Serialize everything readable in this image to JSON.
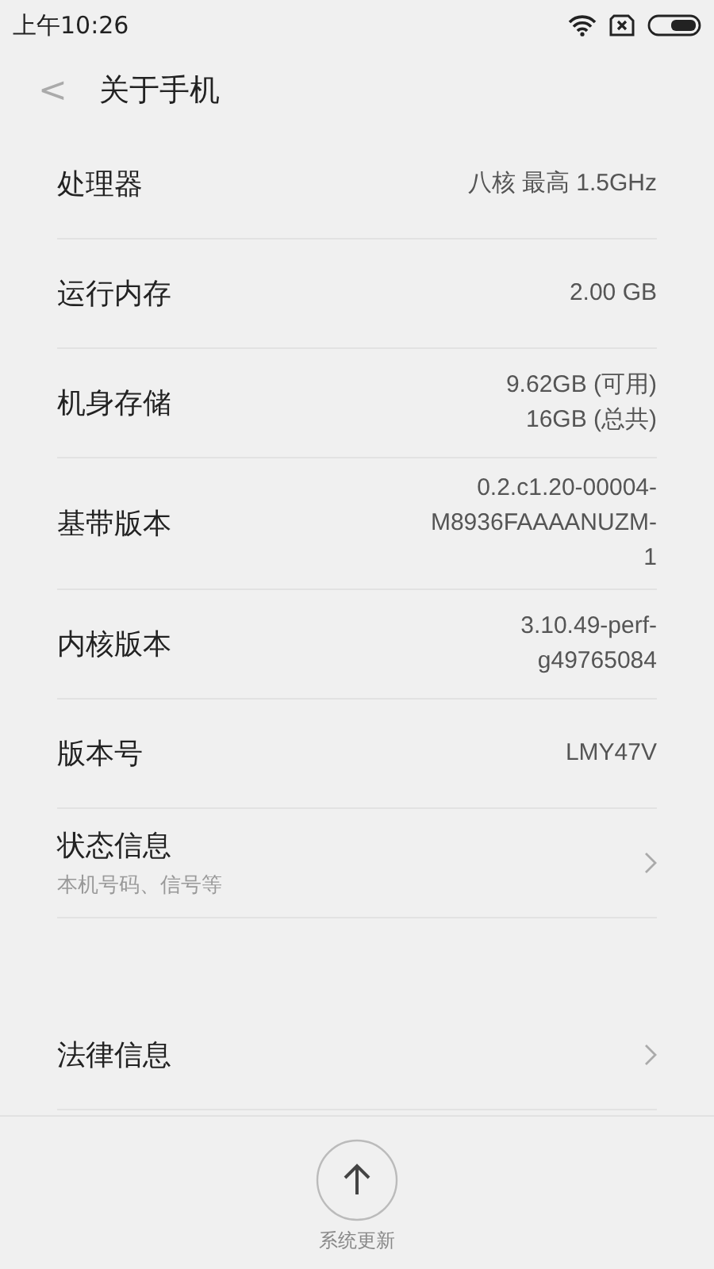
{
  "status_bar": {
    "time": "上午10:26"
  },
  "header": {
    "back": "<",
    "title": "关于手机"
  },
  "sections": [
    {
      "items": [
        {
          "kind": "value",
          "label": "处理器",
          "value_lines": [
            "八核 最高 1.5GHz"
          ]
        },
        {
          "kind": "value",
          "label": "运行内存",
          "value_lines": [
            "2.00 GB"
          ]
        },
        {
          "kind": "value",
          "label": "机身存储",
          "value_lines": [
            "9.62GB (可用)",
            "16GB (总共)"
          ]
        },
        {
          "kind": "value",
          "label": "基带版本",
          "value_lines": [
            "0.2.c1.20-00004-",
            "M8936FAAAANUZM-",
            "1"
          ]
        },
        {
          "kind": "value",
          "label": "内核版本",
          "value_lines": [
            "3.10.49-perf-",
            "g49765084"
          ]
        },
        {
          "kind": "value",
          "label": "版本号",
          "value_lines": [
            "LMY47V"
          ]
        },
        {
          "kind": "link",
          "label": "状态信息",
          "subtitle": "本机号码、信号等"
        }
      ]
    },
    {
      "items": [
        {
          "kind": "link",
          "label": "法律信息"
        }
      ]
    }
  ],
  "bottom_bar": {
    "update_label": "系统更新"
  }
}
